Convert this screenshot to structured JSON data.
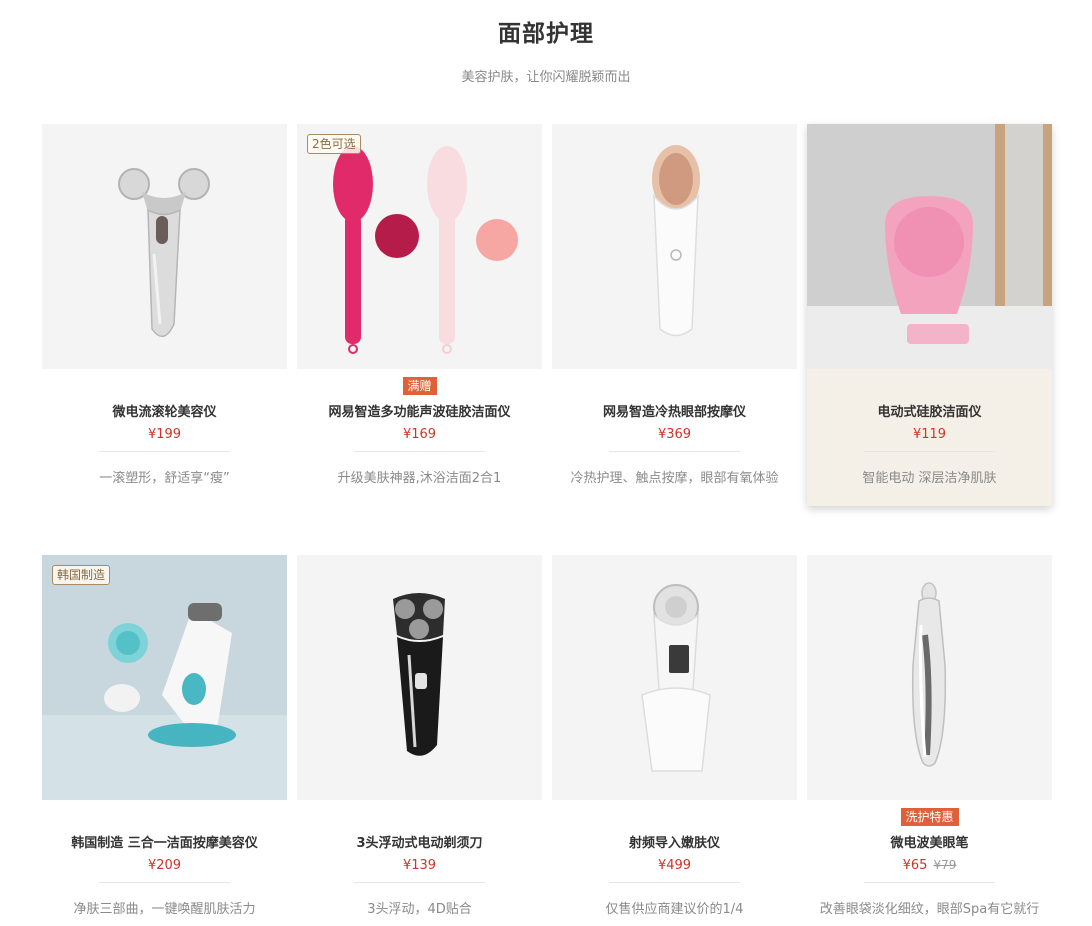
{
  "section": {
    "title": "面部护理",
    "subtitle": "美容护肤，让你闪耀脱颖而出"
  },
  "products": [
    {
      "name": "微电流滚轮美容仪",
      "price": "¥199",
      "desc": "一滚塑形，舒适享“瘦”"
    },
    {
      "name": "网易智造多功能声波硅胶洁面仪",
      "price": "¥169",
      "desc": "升级美肤神器,沐浴洁面2合1",
      "tag": "2色可选",
      "promo": "满赠"
    },
    {
      "name": "网易智造冷热眼部按摩仪",
      "price": "¥369",
      "desc": "冷热护理、触点按摩，眼部有氧体验"
    },
    {
      "name": "电动式硅胶洁面仪",
      "price": "¥119",
      "desc": "智能电动 深层洁净肌肤"
    },
    {
      "name": "韩国制造 三合一洁面按摩美容仪",
      "price": "¥209",
      "desc": "净肤三部曲，一键唤醒肌肤活力",
      "tag": "韩国制造"
    },
    {
      "name": "3头浮动式电动剃须刀",
      "price": "¥139",
      "desc": "3头浮动，4D贴合"
    },
    {
      "name": "射频导入嫩肤仪",
      "price": "¥499",
      "desc": "仅售供应商建议价的1/4"
    },
    {
      "name": "微电波美眼笔",
      "price": "¥65",
      "old_price": "¥79",
      "desc": "改善眼袋淡化细纹，眼部Spa有它就行",
      "promo": "洗护特惠"
    }
  ],
  "images": [
    "roller-device-icon",
    "sonic-cleansing-brush-icon",
    "eye-massager-icon",
    "silicone-cleanser-icon",
    "three-in-one-cleansing-device-icon",
    "electric-shaver-icon",
    "rf-beauty-device-icon",
    "eye-care-pen-icon"
  ],
  "colors": {
    "price": "#d0322b",
    "promo_bg": "#e0603a",
    "highlight_card_bg": "#f4f0e8",
    "tag_border": "#a88b66"
  }
}
